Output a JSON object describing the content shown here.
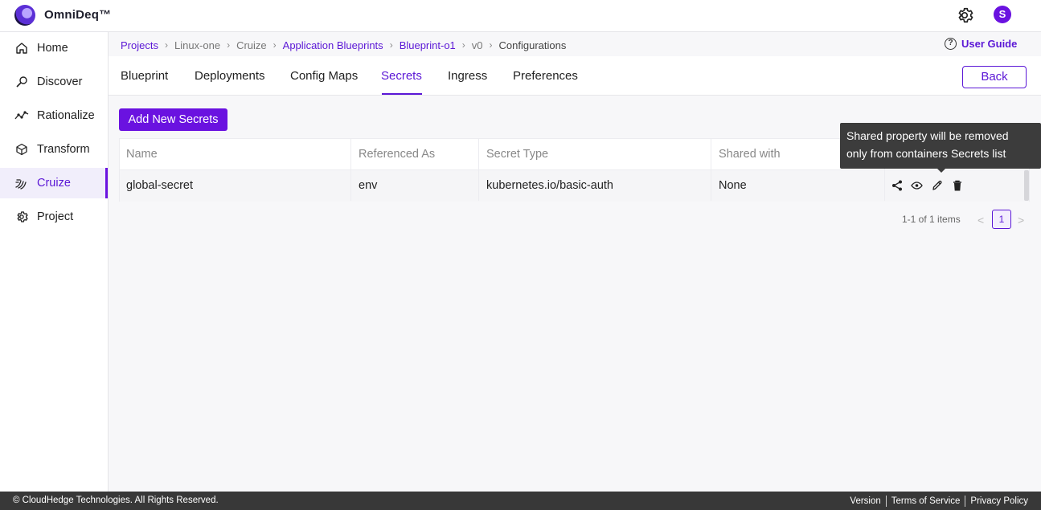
{
  "app": {
    "brand": "OmniDeq™",
    "avatar_initial": "S",
    "accent": "#6a12e0"
  },
  "sidebar": {
    "items": [
      {
        "label": "Home",
        "icon": "home-icon"
      },
      {
        "label": "Discover",
        "icon": "discover-icon"
      },
      {
        "label": "Rationalize",
        "icon": "rationalize-icon"
      },
      {
        "label": "Transform",
        "icon": "cube-icon"
      },
      {
        "label": "Cruize",
        "icon": "cruize-icon",
        "active": true
      },
      {
        "label": "Project",
        "icon": "gear-icon"
      }
    ]
  },
  "breadcrumb": [
    "Projects",
    "Linux-one",
    "Cruize",
    "Application Blueprints",
    "Blueprint-o1",
    "v0",
    "Configurations"
  ],
  "user_guide": "User Guide",
  "tabs": [
    "Blueprint",
    "Deployments",
    "Config Maps",
    "Secrets",
    "Ingress",
    "Preferences"
  ],
  "active_tab": "Secrets",
  "back_label": "Back",
  "add_button": "Add New Secrets",
  "table": {
    "columns": [
      "Name",
      "Referenced As",
      "Secret Type",
      "Shared with"
    ],
    "rows": [
      {
        "name": "global-secret",
        "referenced_as": "env",
        "secret_type": "kubernetes.io/basic-auth",
        "shared_with": "None"
      }
    ]
  },
  "tooltip": {
    "line1": "Shared property will be removed",
    "line2": "only from containers Secrets list"
  },
  "pagination": {
    "summary": "1-1 of 1 items",
    "page": "1",
    "prev": "<",
    "next": ">"
  },
  "footer": {
    "copyright": "© CloudHedge Technologies. All Rights Reserved.",
    "links": [
      "Version",
      "Terms of Service",
      "Privacy Policy"
    ]
  }
}
